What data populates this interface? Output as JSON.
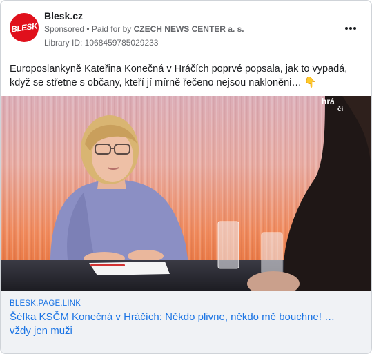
{
  "advertiser": {
    "logo_text": "BLESK",
    "name": "Blesk.cz",
    "sponsored_label": "Sponsored",
    "separator": " • ",
    "paid_prefix": "Paid for by ",
    "paid_by": "CZECH NEWS CENTER a. s.",
    "library_id": "Library ID: 1068459785029233"
  },
  "post": {
    "text": "Europoslankyně Kateřina Konečná v Hráčích poprvé popsala, jak to vypadá, když se střetne s občany, kteří jí mírně řečeno nejsou nakloněni…",
    "emoji": "👇"
  },
  "media": {
    "watermark_line1": "hrá",
    "watermark_line2": "či"
  },
  "link": {
    "domain": "BLESK.PAGE.LINK",
    "title": "Šéfka KSČM Konečná v Hráčích: Někdo plivne, někdo mě bouchne! … vždy jen muži"
  },
  "colors": {
    "brand": "#e0101c",
    "link": "#1b74e4",
    "meta": "#65676b"
  },
  "icons": {
    "more": "more-dots-icon"
  }
}
